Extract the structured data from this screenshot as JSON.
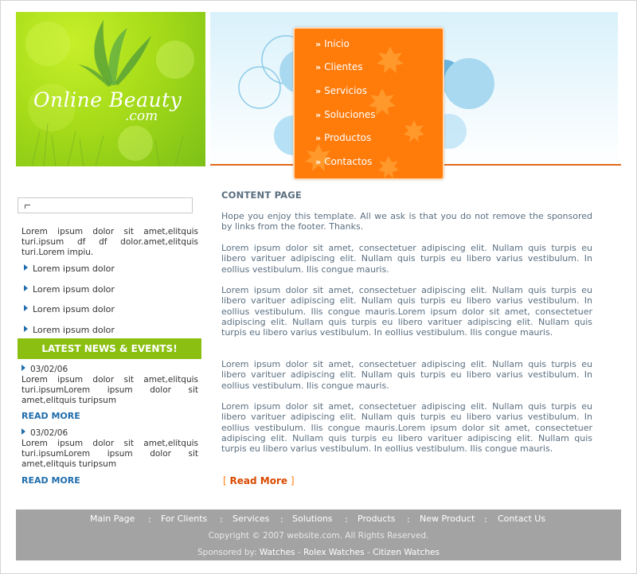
{
  "logo": {
    "main": "Online Beauty",
    "sub": ".com"
  },
  "nav": {
    "items": [
      "Inicio",
      "Clientes",
      "Servicios",
      "Soluciones",
      "Productos",
      "Contactos"
    ],
    "bullet": "»"
  },
  "colors": {
    "accent_orange": "#ff7b0a",
    "green": "#8bbf12",
    "link_blue": "#1f6dac",
    "footer_gray": "#a3a3a3",
    "text_gray": "#5b6f80"
  },
  "sidebar": {
    "search_value": "",
    "intro": "Lorem ipsum dolor sit amet,elitquis turi.ipsum df df dolor.amet,elitquis turi.Lorem impiu.",
    "links": [
      "Lorem ipsum dolor",
      "Lorem ipsum dolor",
      "Lorem ipsum dolor",
      "Lorem ipsum dolor"
    ],
    "news_heading": "LATEST NEWS & EVENTS!",
    "news": [
      {
        "date": "03/02/06",
        "text": "Lorem ipsum dolor sit amet,elitquis turi.ipsumLorem ipsum dolor sit amet,elitquis turipsum",
        "read_more": "READ MORE"
      },
      {
        "date": "03/02/06",
        "text": "Lorem ipsum dolor sit amet,elitquis turi.ipsumLorem ipsum dolor sit amet,elitquis turipsum",
        "read_more": "READ MORE"
      }
    ]
  },
  "main": {
    "title": "CONTENT PAGE",
    "paragraphs": [
      "Hope you enjoy this template. All we ask is that you do not remove the sponsored by links from the footer. Thanks.",
      "Lorem ipsum dolor sit amet, consectetuer adipiscing elit. Nullam quis turpis eu libero varituer adipiscing elit. Nullam quis turpis eu libero varius vestibulum. In eollius vestibulum. Ilis congue mauris.",
      "Lorem ipsum dolor sit amet, consectetuer adipiscing elit. Nullam quis turpis eu libero varituer adipiscing elit. Nullam quis turpis eu libero varius vestibulum. In eollius vestibulum. Ilis congue mauris.Lorem ipsum dolor sit amet, consectetuer adipiscing elit. Nullam quis turpis eu libero varituer adipiscing elit. Nullam quis turpis eu libero varius vestibulum. In eollius vestibulum. Ilis congue mauris.",
      "Lorem ipsum dolor sit amet, consectetuer adipiscing elit. Nullam quis turpis eu libero varituer adipiscing elit. Nullam quis turpis eu libero varius vestibulum. In eollius vestibulum. Ilis congue mauris.",
      "Lorem ipsum dolor sit amet, consectetuer adipiscing elit. Nullam quis turpis eu libero varituer adipiscing elit. Nullam quis turpis eu libero varius vestibulum. In eollius vestibulum. Ilis congue mauris.Lorem ipsum dolor sit amet, consectetuer adipiscing elit. Nullam quis turpis eu libero varituer adipiscing elit. Nullam quis turpis eu libero varius vestibulum. In eollius vestibulum. Ilis congue mauris."
    ],
    "read_more_open": "[",
    "read_more": "Read More",
    "read_more_close": "]"
  },
  "footer": {
    "links": [
      "Main Page",
      "For Clients",
      "Services",
      "Solutions",
      "Products",
      "New Product",
      "Contact Us"
    ],
    "separator": ":",
    "copyright": "Copyright © 2007 website.com. All Rights Reserved.",
    "sponsored_label": "Sponsored by:",
    "sponsors": [
      "Watches",
      "Rolex Watches",
      "Citizen Watches"
    ],
    "sponsor_separator": "-"
  }
}
